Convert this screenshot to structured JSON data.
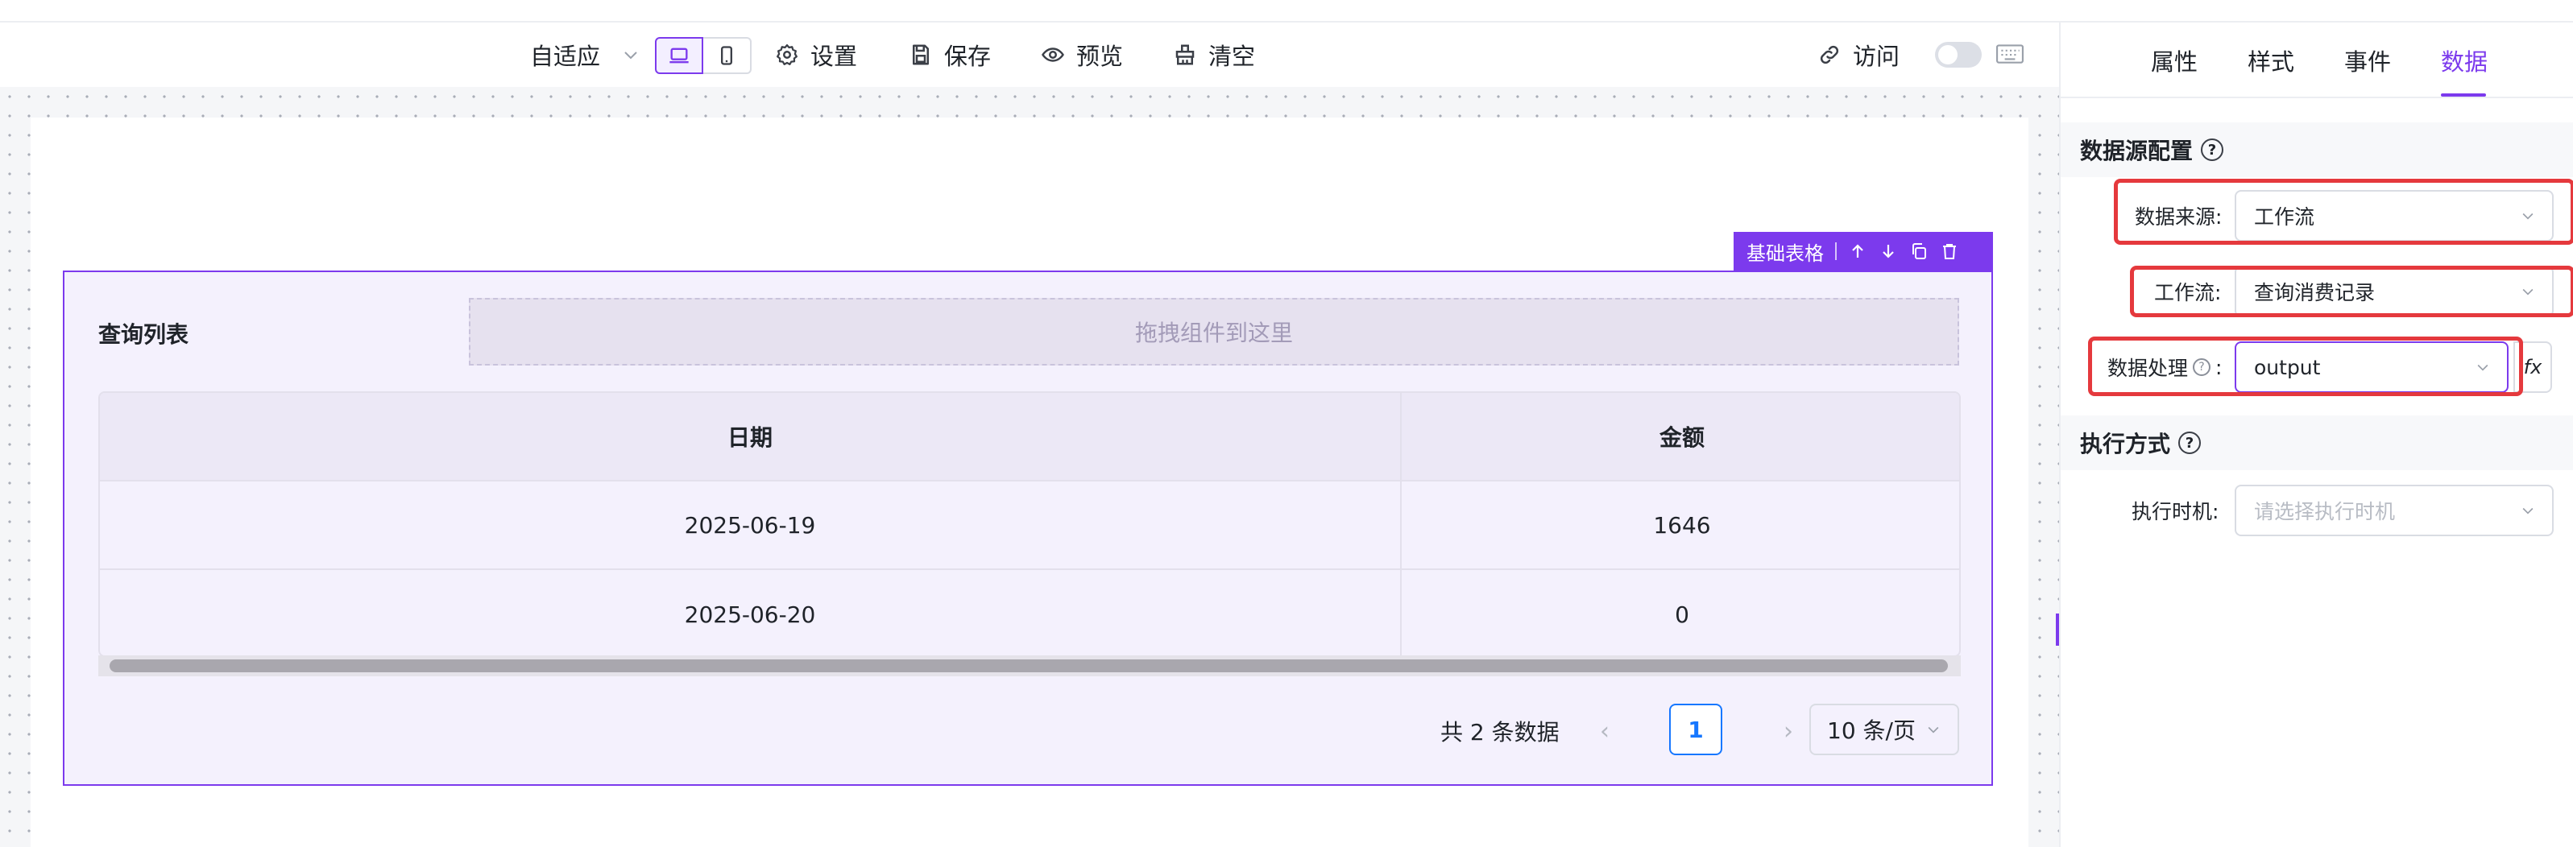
{
  "toolbar": {
    "adaptive_label": "自适应",
    "settings_label": "设置",
    "save_label": "保存",
    "preview_label": "预览",
    "clear_label": "清空",
    "visit_label": "访问"
  },
  "component_tag": {
    "label": "基础表格"
  },
  "table_block": {
    "title": "查询列表",
    "dropzone_text": "拖拽组件到这里",
    "columns": [
      "日期",
      "金额"
    ],
    "rows": [
      [
        "2025-06-19",
        "1646"
      ],
      [
        "2025-06-20",
        "0"
      ]
    ],
    "pagination": {
      "total_text": "共 2 条数据",
      "current_page": "1",
      "page_size": "10 条/页"
    }
  },
  "panel": {
    "tabs": [
      "属性",
      "样式",
      "事件",
      "数据"
    ],
    "active_tab": "数据",
    "datasource_section": "数据源配置",
    "source_label": "数据来源:",
    "source_value": "工作流",
    "workflow_label": "工作流:",
    "workflow_value": "查询消费记录",
    "process_label": "数据处理",
    "process_colon": ":",
    "process_value": "output",
    "fx_label": "fx",
    "exec_section": "执行方式",
    "timing_label": "执行时机:",
    "timing_placeholder": "请选择执行时机"
  },
  "colors": {
    "accent": "#7c3aed",
    "highlight_box": "#e5393d",
    "page_active": "#1677ff"
  }
}
